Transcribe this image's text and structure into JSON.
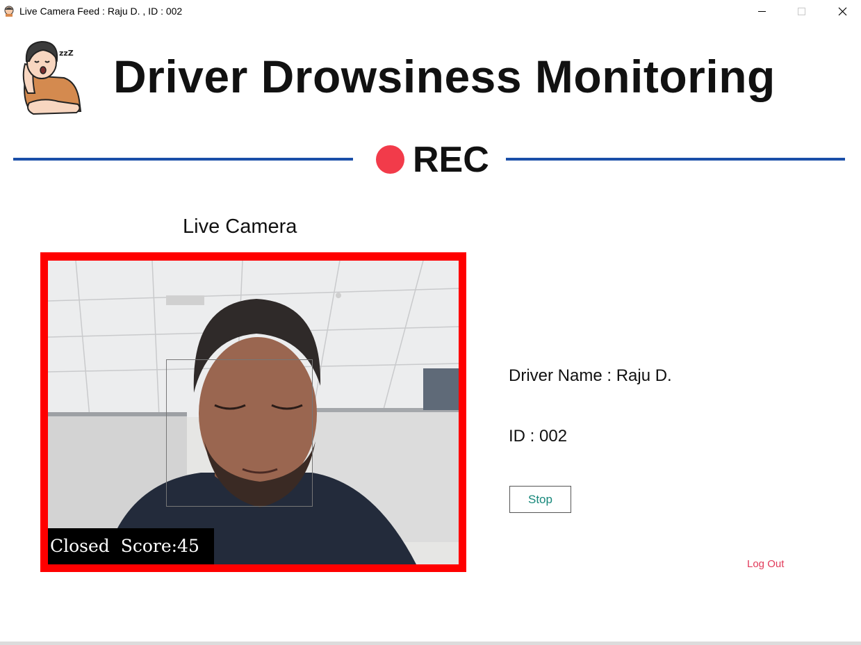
{
  "window": {
    "title": "Live Camera Feed : Raju D. , ID : 002",
    "icons": {
      "app": "sleepy-driver-icon",
      "minimize": "minimize-icon",
      "maximize": "maximize-icon",
      "close": "close-icon"
    }
  },
  "header": {
    "logo": "sleepy-driver-logo",
    "logo_text": "zzZ",
    "title": "Driver Drowsiness Monitoring"
  },
  "recording": {
    "label": "REC",
    "dot_color": "#f23b4a",
    "rule_color": "#1a4fa8"
  },
  "camera": {
    "label": "Live Camera",
    "border_color": "#ff0000",
    "overlay_text": "Closed  Score:45"
  },
  "driver": {
    "name_text": "Driver Name : Raju D.",
    "id_text": "ID : 002"
  },
  "actions": {
    "stop_label": "Stop",
    "logout_label": "Log Out",
    "logout_color": "#e23a5a"
  }
}
